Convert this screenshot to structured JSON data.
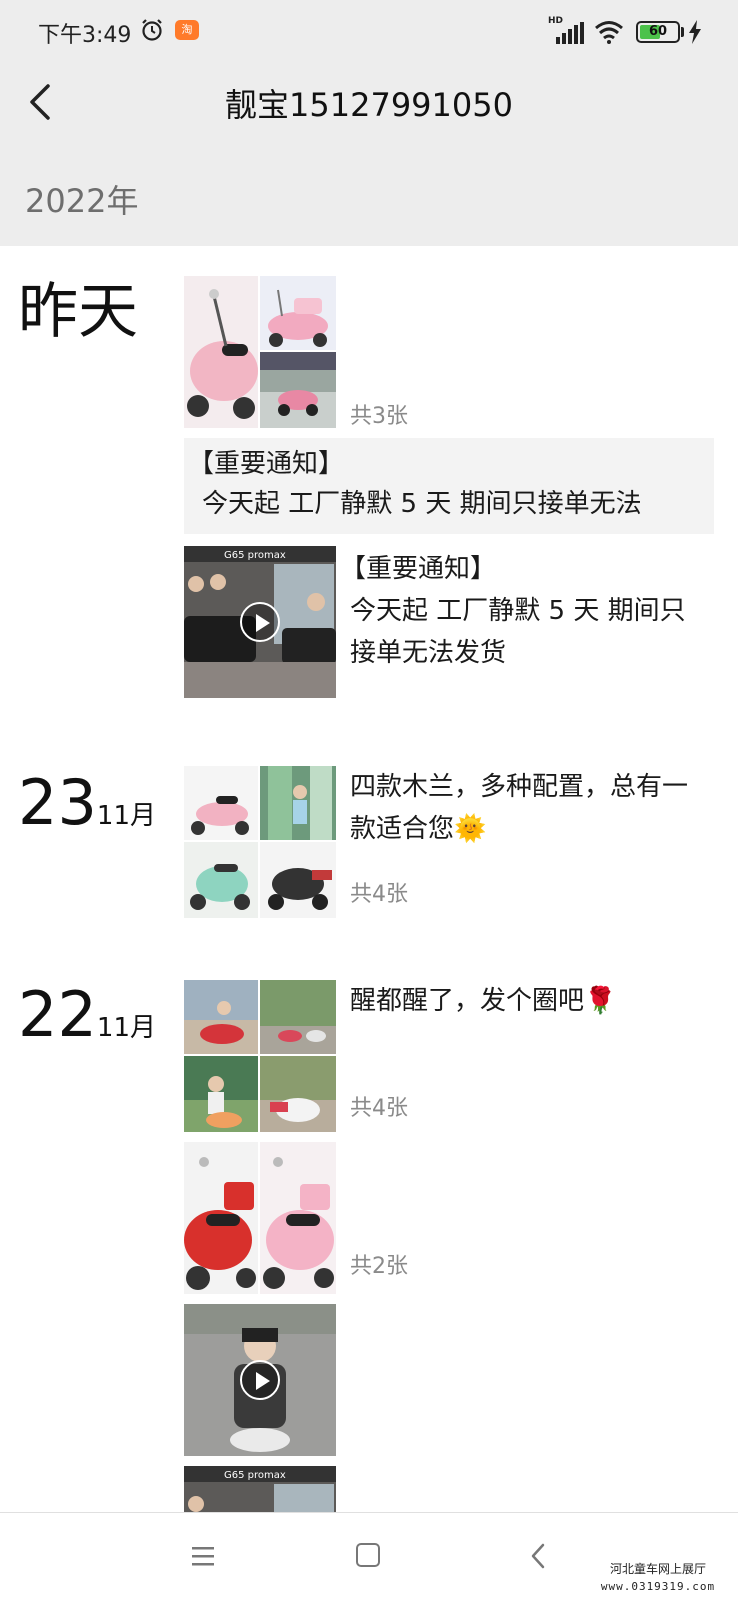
{
  "status_bar": {
    "time": "下午3:49",
    "network": "HD",
    "battery": "60",
    "battery_level": 0.6
  },
  "header": {
    "title": "靓宝15127991050",
    "back_icon": "chevron-left-icon"
  },
  "year": "2022年",
  "posts": [
    {
      "date_word": "昨天",
      "count": "共3张"
    },
    {
      "notice_title": "【重要通知】",
      "notice_body": "今天起 工厂静默 5 天  期间只接单无法"
    },
    {
      "video_title": "【重要通知】",
      "video_text": "今天起 工厂静默 5 天  期间只接单无法发货"
    },
    {
      "day": "23",
      "month": "11月",
      "text": "四款木兰，多种配置，总有一款适合您🌞",
      "count": "共4张"
    },
    {
      "day": "22",
      "month": "11月",
      "text": "醒都醒了，发个圈吧🌹",
      "count": "共4张"
    },
    {
      "count": "共2张"
    }
  ],
  "bottom_nav": {
    "menu_icon": "menu-icon",
    "home_icon": "home-icon",
    "back_icon": "back-icon"
  },
  "watermark": {
    "line1": "河北童车网上展厅",
    "line2": "www.0319319.com"
  }
}
